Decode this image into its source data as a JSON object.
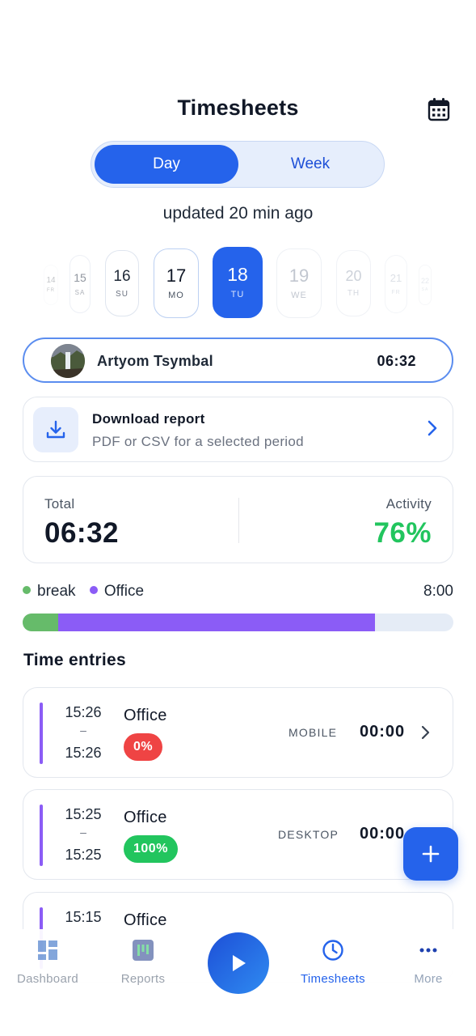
{
  "header": {
    "title": "Timesheets",
    "calendar_icon": "calendar-icon"
  },
  "view_toggle": {
    "day_label": "Day",
    "week_label": "Week",
    "selected": "Day"
  },
  "status": {
    "updated_text": "updated 20 min ago"
  },
  "date_strip": [
    {
      "num": "14",
      "dow": "FR"
    },
    {
      "num": "15",
      "dow": "SA"
    },
    {
      "num": "16",
      "dow": "SU"
    },
    {
      "num": "17",
      "dow": "MO"
    },
    {
      "num": "18",
      "dow": "TU"
    },
    {
      "num": "19",
      "dow": "WE"
    },
    {
      "num": "20",
      "dow": "TH"
    },
    {
      "num": "21",
      "dow": "FR"
    },
    {
      "num": "22",
      "dow": "SA"
    }
  ],
  "selected_date": "18",
  "user": {
    "name": "Artyom Tsymbal",
    "time": "06:32"
  },
  "download": {
    "title": "Download report",
    "subtitle": "PDF or CSV for a selected period"
  },
  "stats": {
    "total_label": "Total",
    "total_value": "06:32",
    "activity_label": "Activity",
    "activity_value": "76%"
  },
  "legend": {
    "items": [
      {
        "label": "break",
        "color": "#66bb6a"
      },
      {
        "label": "Office",
        "color": "#8b5cf6"
      }
    ],
    "target": "8:00"
  },
  "progress": {
    "break_fraction": 0.083,
    "office_fraction": 0.735
  },
  "entries_title": "Time entries",
  "entries": [
    {
      "start": "15:26",
      "sep": "–",
      "end": "15:26",
      "project": "Office",
      "activity": "0%",
      "activity_color": "#ef4444",
      "source": "MOBILE",
      "duration": "00:00"
    },
    {
      "start": "15:25",
      "sep": "–",
      "end": "15:25",
      "project": "Office",
      "activity": "100%",
      "activity_color": "#22c55e",
      "source": "DESKTOP",
      "duration": "00:00"
    },
    {
      "start": "15:15",
      "sep": "",
      "end": "",
      "project": "Office",
      "activity": "",
      "activity_color": "",
      "source": "",
      "duration": ""
    }
  ],
  "nav": {
    "dashboard": "Dashboard",
    "reports": "Reports",
    "timesheets": "Timesheets",
    "more": "More",
    "active": "Timesheets",
    "accent": "#2563eb"
  }
}
